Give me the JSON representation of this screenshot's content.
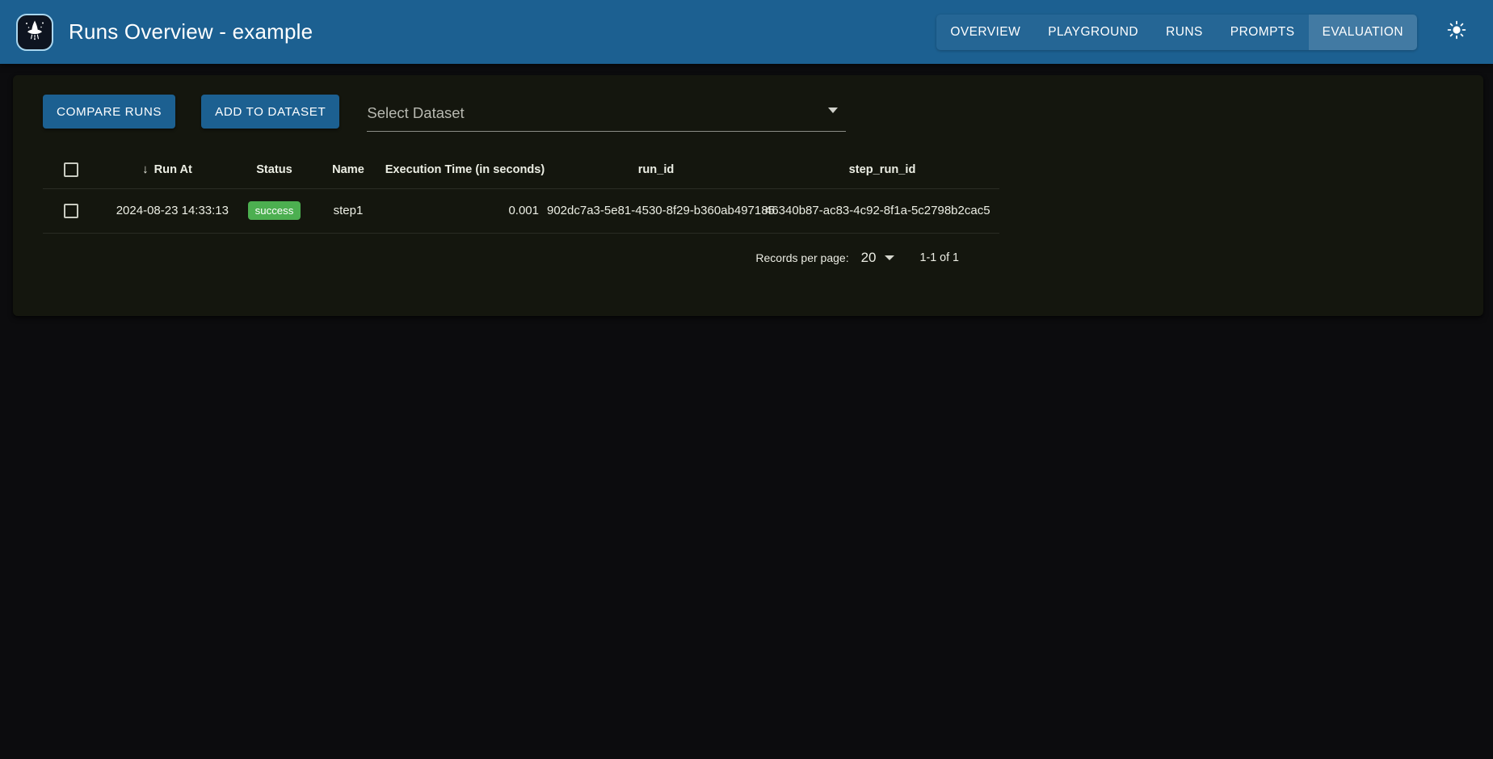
{
  "appbar": {
    "logo_icon": "wizard-hat-icon",
    "title": "Runs Overview - example",
    "nav": [
      {
        "label": "OVERVIEW",
        "active": false
      },
      {
        "label": "PLAYGROUND",
        "active": false
      },
      {
        "label": "RUNS",
        "active": false
      },
      {
        "label": "PROMPTS",
        "active": false
      },
      {
        "label": "EVALUATION",
        "active": true
      }
    ],
    "theme_toggle_icon": "sun-icon",
    "background_color": "#1c6091"
  },
  "toolbar": {
    "compare_runs_label": "COMPARE RUNS",
    "add_to_dataset_label": "ADD TO DATASET",
    "dataset_select": {
      "placeholder": "Select Dataset",
      "value": "",
      "arrow_icon": "chevron-down-icon"
    }
  },
  "table": {
    "sort_arrow": "↓",
    "sorted_column": "Run At",
    "columns": [
      "Run At",
      "Status",
      "Name",
      "Execution Time (in seconds)",
      "run_id",
      "step_run_id"
    ],
    "rows": [
      {
        "selected": false,
        "run_at": "2024-08-23 14:33:13",
        "status": "success",
        "status_color": "#4caf50",
        "name": "step1",
        "execution_time": "0.001",
        "run_id": "902dc7a3-5e81-4530-8f29-b360ab497185",
        "step_run_id": "46340b87-ac83-4c92-8f1a-5c2798b2cac5"
      }
    ]
  },
  "pagination": {
    "records_per_page_label": "Records per page:",
    "records_per_page_value": "20",
    "range_label": "1-1 of 1"
  }
}
